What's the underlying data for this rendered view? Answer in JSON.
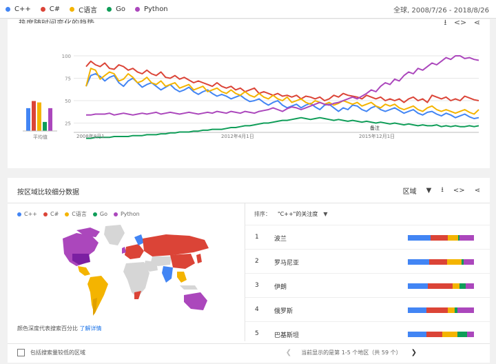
{
  "legend": [
    {
      "name": "C++",
      "color": "#4285f4"
    },
    {
      "name": "C#",
      "color": "#db4437"
    },
    {
      "name": "C语言",
      "color": "#f4b400"
    },
    {
      "name": "Go",
      "color": "#0f9d58"
    },
    {
      "name": "Python",
      "color": "#ab47bc"
    }
  ],
  "date_range": "全球, 2008/7/26 - 2018/8/26",
  "card1": {
    "title": "热度随时间变化的趋势",
    "avg_label": "平均值",
    "annotation": "备注"
  },
  "chart_data": {
    "type": "line",
    "title": "热度随时间变化的趋势",
    "x_ticks": [
      "2008年8月1...",
      "2012年4月1日",
      "2015年12月1日"
    ],
    "y_ticks": [
      100,
      75,
      50,
      25
    ],
    "ylim": [
      0,
      100
    ],
    "grid": true,
    "averages": [
      {
        "name": "C++",
        "value": 48
      },
      {
        "name": "C#",
        "value": 63
      },
      {
        "name": "C语言",
        "value": 60
      },
      {
        "name": "Go",
        "value": 19
      },
      {
        "name": "Python",
        "value": 48
      }
    ],
    "series": [
      {
        "name": "C++",
        "color": "#4285f4",
        "values": [
          66,
          78,
          80,
          77,
          72,
          76,
          78,
          70,
          66,
          72,
          75,
          70,
          65,
          68,
          70,
          66,
          62,
          65,
          68,
          63,
          60,
          62,
          65,
          60,
          57,
          60,
          62,
          58,
          55,
          57,
          55,
          52,
          54,
          56,
          52,
          49,
          50,
          52,
          48,
          45,
          48,
          50,
          45,
          42,
          44,
          46,
          42,
          45,
          47,
          43,
          40,
          45,
          46,
          42,
          38,
          42,
          40,
          45,
          44,
          40,
          38,
          42,
          44,
          40,
          38,
          40,
          42,
          39,
          36,
          38,
          40,
          36,
          34,
          37,
          38,
          35,
          33,
          36,
          34,
          31,
          33,
          35,
          32,
          30,
          31
        ]
      },
      {
        "name": "C#",
        "color": "#db4437",
        "values": [
          88,
          94,
          90,
          88,
          92,
          86,
          85,
          90,
          88,
          84,
          86,
          82,
          80,
          84,
          80,
          78,
          82,
          76,
          75,
          78,
          74,
          76,
          73,
          70,
          72,
          70,
          68,
          66,
          70,
          66,
          64,
          66,
          62,
          64,
          60,
          62,
          64,
          58,
          60,
          58,
          56,
          58,
          55,
          56,
          54,
          56,
          52,
          55,
          54,
          52,
          54,
          50,
          52,
          56,
          54,
          58,
          56,
          55,
          54,
          52,
          56,
          54,
          52,
          54,
          50,
          52,
          50,
          52,
          48,
          52,
          54,
          50,
          52,
          48,
          56,
          54,
          52,
          54,
          50,
          52,
          50,
          55,
          53,
          51,
          50
        ]
      },
      {
        "name": "C语言",
        "color": "#f4b400",
        "values": [
          66,
          86,
          84,
          74,
          78,
          82,
          80,
          72,
          74,
          80,
          76,
          70,
          72,
          76,
          70,
          68,
          72,
          66,
          68,
          70,
          64,
          66,
          68,
          62,
          64,
          66,
          60,
          62,
          64,
          60,
          58,
          62,
          58,
          56,
          60,
          56,
          54,
          58,
          54,
          52,
          56,
          52,
          50,
          54,
          48,
          50,
          52,
          48,
          46,
          50,
          48,
          46,
          48,
          45,
          47,
          50,
          48,
          46,
          48,
          44,
          46,
          48,
          44,
          42,
          46,
          44,
          46,
          42,
          40,
          42,
          44,
          40,
          38,
          42,
          44,
          40,
          38,
          40,
          38,
          36,
          38,
          40,
          37,
          35,
          40
        ]
      },
      {
        "name": "Go",
        "color": "#0f9d58",
        "values": [
          8,
          8,
          9,
          9,
          9,
          9,
          10,
          10,
          10,
          10,
          11,
          11,
          11,
          12,
          12,
          12,
          13,
          13,
          14,
          14,
          15,
          15,
          15,
          16,
          16,
          17,
          17,
          18,
          18,
          18,
          19,
          20,
          20,
          21,
          22,
          22,
          23,
          24,
          25,
          25,
          26,
          27,
          28,
          28,
          29,
          30,
          31,
          30,
          29,
          30,
          31,
          30,
          29,
          28,
          29,
          28,
          27,
          28,
          27,
          26,
          27,
          26,
          25,
          26,
          25,
          24,
          25,
          24,
          23,
          24,
          23,
          22,
          23,
          22,
          22,
          23,
          21,
          22,
          21,
          22,
          21,
          21,
          22,
          21,
          22
        ]
      },
      {
        "name": "Python",
        "color": "#ab47bc",
        "values": [
          34,
          34,
          35,
          35,
          35,
          36,
          34,
          35,
          36,
          35,
          34,
          35,
          36,
          35,
          36,
          37,
          35,
          36,
          37,
          36,
          35,
          36,
          37,
          36,
          35,
          36,
          37,
          36,
          38,
          37,
          36,
          38,
          37,
          36,
          38,
          37,
          36,
          38,
          39,
          40,
          42,
          40,
          38,
          41,
          43,
          42,
          40,
          42,
          44,
          46,
          48,
          46,
          45,
          47,
          48,
          50,
          52,
          54,
          52,
          55,
          58,
          62,
          60,
          66,
          70,
          68,
          74,
          72,
          78,
          82,
          80,
          86,
          84,
          88,
          92,
          90,
          94,
          98,
          96,
          100,
          100,
          97,
          98,
          96,
          95
        ]
      }
    ]
  },
  "card2": {
    "title": "按区域比较细分数据",
    "region_label": "区域",
    "sort_label": "排序：",
    "sort_value": "\"C++\"的关注度",
    "note": "颜色深度代表搜索百分比",
    "note_link": "了解详情",
    "include_low_label": "包括搜索量较低的区域",
    "pager_text": "当前显示的是第 1-5 个地区（共 59 个）"
  },
  "regions": [
    {
      "rank": "1",
      "name": "波兰",
      "shares": [
        0.34,
        0.26,
        0.16,
        0.02,
        0.22
      ]
    },
    {
      "rank": "2",
      "name": "罗马尼亚",
      "shares": [
        0.32,
        0.27,
        0.22,
        0.03,
        0.16
      ]
    },
    {
      "rank": "3",
      "name": "伊朗",
      "shares": [
        0.3,
        0.38,
        0.1,
        0.1,
        0.12
      ]
    },
    {
      "rank": "4",
      "name": "俄罗斯",
      "shares": [
        0.28,
        0.32,
        0.11,
        0.04,
        0.25
      ]
    },
    {
      "rank": "5",
      "name": "巴基斯坦",
      "shares": [
        0.28,
        0.24,
        0.23,
        0.15,
        0.1
      ]
    }
  ]
}
